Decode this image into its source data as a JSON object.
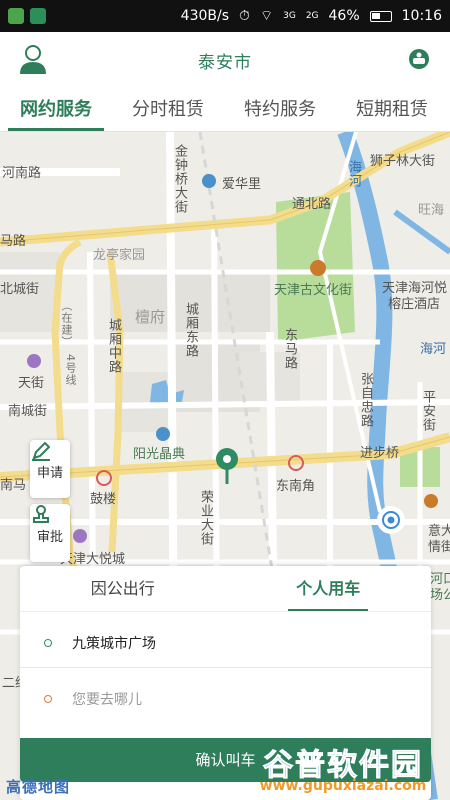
{
  "status_bar": {
    "speed": "430B/s",
    "network_a": "3G",
    "network_b": "2G",
    "battery": "46%",
    "time": "10:16"
  },
  "header": {
    "title": "泰安市",
    "avatar_icon": "user-avatar-icon",
    "message_icon": "customer-service-icon"
  },
  "tabs": [
    {
      "label": "网约服务",
      "active": true
    },
    {
      "label": "分时租赁",
      "active": false
    },
    {
      "label": "特约服务",
      "active": false
    },
    {
      "label": "短期租赁",
      "active": false
    }
  ],
  "map": {
    "labels": {
      "hnl": "河南路",
      "jzqj": "金钟桥大街",
      "aihuali": "爱华里",
      "haihe": "海河",
      "szl": "狮子林大街",
      "wangha": "旺海",
      "malu": "马路",
      "tongbeilu": "通北路",
      "longting": "龙亭家园",
      "bcj": "北城街",
      "tanfu": "檀府",
      "cxdl": "城厢东路",
      "cxzl": "城厢中路",
      "zaijian": "（在建）",
      "line4": "4号线",
      "tjgwhj": "天津古文化街",
      "tjhhy": "天津海河悦",
      "rzjd": "榕庄酒店",
      "haihe2": "海河",
      "tianjie": "天街",
      "dml": "东马路",
      "zzl": "张自忠路",
      "pingan": "平安街",
      "ncj": "南城街",
      "ygjd": "阳光晶典",
      "jinbuqiao": "进步桥",
      "nanma": "南马",
      "gulou": "鼓楼",
      "dongnanjiao": "东南角",
      "ryd": "荣业大街",
      "yida": "意大",
      "qingjie": "情街",
      "tjdyc": "天津大悦城",
      "hekou": "河口",
      "chang": "场公",
      "erwei": "二纬"
    },
    "buttons": {
      "apply": "申请",
      "approve": "审批"
    }
  },
  "card": {
    "tabs": [
      {
        "label": "因公出行",
        "active": false
      },
      {
        "label": "个人用车",
        "active": true
      }
    ],
    "start": "九策城市广场",
    "end_placeholder": "您要去哪儿",
    "confirm": "确认叫车"
  },
  "footer": {
    "map_brand": "高德地图",
    "watermark_title": "谷普软件园",
    "watermark_url": "www.gupuxiazai.com"
  },
  "colors": {
    "brand_green": "#2e7d5b",
    "end_dot": "#e07a3a",
    "river": "#7fb6e3",
    "park": "#b8dc9a",
    "road_yellow": "#f3dc8c"
  }
}
